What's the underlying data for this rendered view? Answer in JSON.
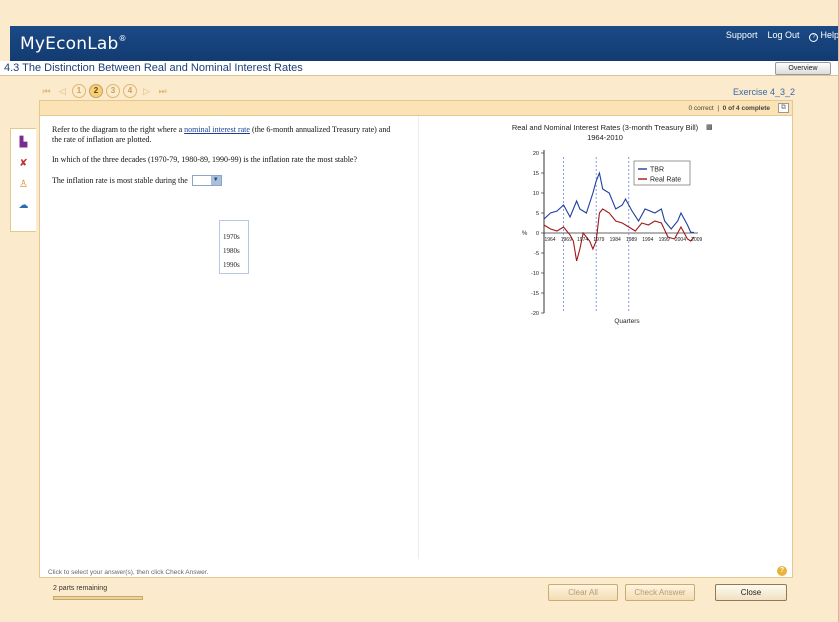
{
  "app": {
    "brand": "MyEconLab",
    "brand_mark": "®"
  },
  "toplinks": {
    "support": "Support",
    "logout": "Log Out",
    "help": "Help"
  },
  "section": {
    "title": "4.3  The Distinction Between Real and Nominal Interest Rates",
    "overview": "Overview"
  },
  "nav": {
    "questions": [
      "1",
      "2",
      "3",
      "4"
    ],
    "active_index": 1
  },
  "exercise": {
    "id": "Exercise 4_3_2"
  },
  "status": {
    "correct": "0 correct",
    "complete": "0 of 4 complete"
  },
  "question": {
    "intro_before": "Refer to the diagram to the right where a ",
    "intro_link": "nominal interest rate",
    "intro_after": " (the 6-month annualized Treasury rate) and the rate of inflation are plotted.",
    "prompt": "In which of the three decades (1970-79, 1980-89, 1990-99) is the inflation rate the most stable?",
    "answer_label": "The inflation rate is most stable during the",
    "options": [
      "1970s",
      "1980s",
      "1990s"
    ]
  },
  "chart_data": {
    "type": "line",
    "title": "Real and Nominal Interest Rates (3-month Treasury Bill) 1964-2010",
    "xlabel": "Quarters",
    "ylabel": "%",
    "ylim": [
      -20,
      20
    ],
    "yticks": [
      20,
      15,
      10,
      5,
      0,
      -5,
      -10,
      -15,
      -20
    ],
    "xticks": [
      "1964",
      "1969",
      "1974",
      "1979",
      "1984",
      "1989",
      "1994",
      "1999",
      "2004",
      "2009"
    ],
    "vlines": [
      1970,
      1980,
      1990
    ],
    "series": [
      {
        "name": "TBR",
        "color": "#1f3f9f",
        "x": [
          1964,
          1966,
          1968,
          1970,
          1972,
          1974,
          1975,
          1977,
          1979,
          1980,
          1981,
          1982,
          1984,
          1986,
          1988,
          1989,
          1991,
          1993,
          1995,
          1998,
          2000,
          2001,
          2003,
          2005,
          2006,
          2008,
          2009,
          2010
        ],
        "y": [
          3.5,
          5,
          5.5,
          7,
          4,
          8,
          6,
          5,
          10,
          13,
          15,
          11,
          10,
          6,
          7,
          8.5,
          5.5,
          3,
          6,
          5,
          6,
          3,
          1,
          3,
          5,
          2,
          0.2,
          0.1
        ]
      },
      {
        "name": "Real Rate",
        "color": "#a01818",
        "x": [
          1964,
          1966,
          1968,
          1970,
          1972,
          1973,
          1974,
          1975,
          1976,
          1977,
          1978,
          1979,
          1980,
          1981,
          1982,
          1984,
          1986,
          1988,
          1990,
          1992,
          1994,
          1996,
          1998,
          2000,
          2002,
          2004,
          2006,
          2008,
          2009,
          2010
        ],
        "y": [
          2,
          1,
          0.5,
          1.5,
          -0.5,
          -2,
          -7,
          -4,
          0,
          -1,
          -2,
          -4,
          -2,
          5,
          6,
          5,
          3,
          2.5,
          1.5,
          0.5,
          2.5,
          2,
          3,
          2.5,
          -1,
          -1.5,
          1.5,
          -1.5,
          -2,
          -1
        ]
      }
    ]
  },
  "instructions": "Click to select your answer(s), then click Check Answer.",
  "footer": {
    "parts": "2 parts remaining",
    "progress_fraction": 0,
    "clear": "Clear All",
    "check": "Check Answer",
    "close": "Close"
  }
}
